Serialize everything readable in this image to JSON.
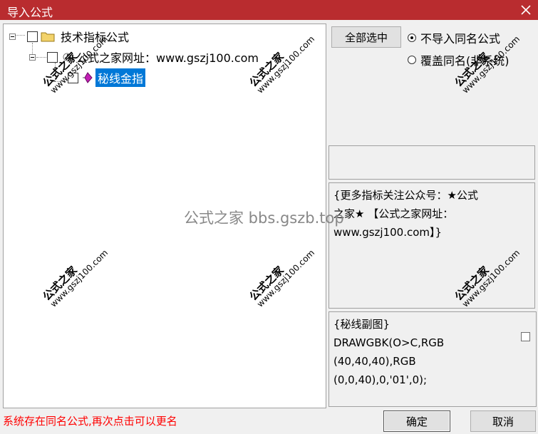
{
  "window": {
    "title": "导入公式"
  },
  "tree": {
    "root_label": "技术指标公式",
    "group_label": "公式之家网址：www.gszj100.com",
    "item_label": "秘线金指"
  },
  "buttons": {
    "select_all": "全部选中",
    "ok": "确定",
    "cancel": "取消"
  },
  "options": {
    "skip_same": "不导入同名公式",
    "overwrite": "覆盖同名(非系统)"
  },
  "description": {
    "line1": "{更多指标关注公众号：★公式",
    "line2": "之家★ 【公式之家网址：",
    "line3": "www.gszj100.com】}"
  },
  "code": {
    "line1": "{秘线副图}",
    "line2": "DRAWGBK(O>C,RGB",
    "line3": "(40,40,40),RGB",
    "line4": "(0,0,40),0,'01',0);"
  },
  "status": "系统存在同名公式,再次点击可以更名",
  "watermark": {
    "name": "公式之家",
    "url": "www.gszj100.com",
    "center": "公式之家 bbs.gszb.top"
  }
}
